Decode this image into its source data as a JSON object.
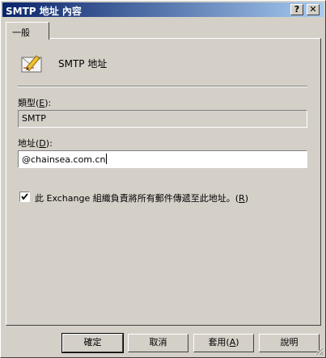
{
  "window": {
    "title": "SMTP 地址 內容",
    "help_button": "?",
    "close_button": "✕"
  },
  "tab": {
    "label": "一般"
  },
  "header": {
    "name": "SMTP 地址",
    "icon": "edit-address-icon"
  },
  "type_field": {
    "label": "類型(",
    "hotkey": "E",
    "label_end": "):",
    "value": "SMTP"
  },
  "address_field": {
    "label": "地址(",
    "hotkey": "D",
    "label_end": "):",
    "value": "@chainsea.com.cn"
  },
  "checkbox": {
    "checked": true,
    "label": "此 Exchange 組織負責將所有郵件傳遞至此地址。(",
    "hotkey": "R",
    "label_end": ")"
  },
  "buttons": {
    "ok": "確定",
    "cancel": "取消",
    "apply": "套用(",
    "apply_hotkey": "A",
    "apply_end": ")",
    "help": "說明"
  }
}
